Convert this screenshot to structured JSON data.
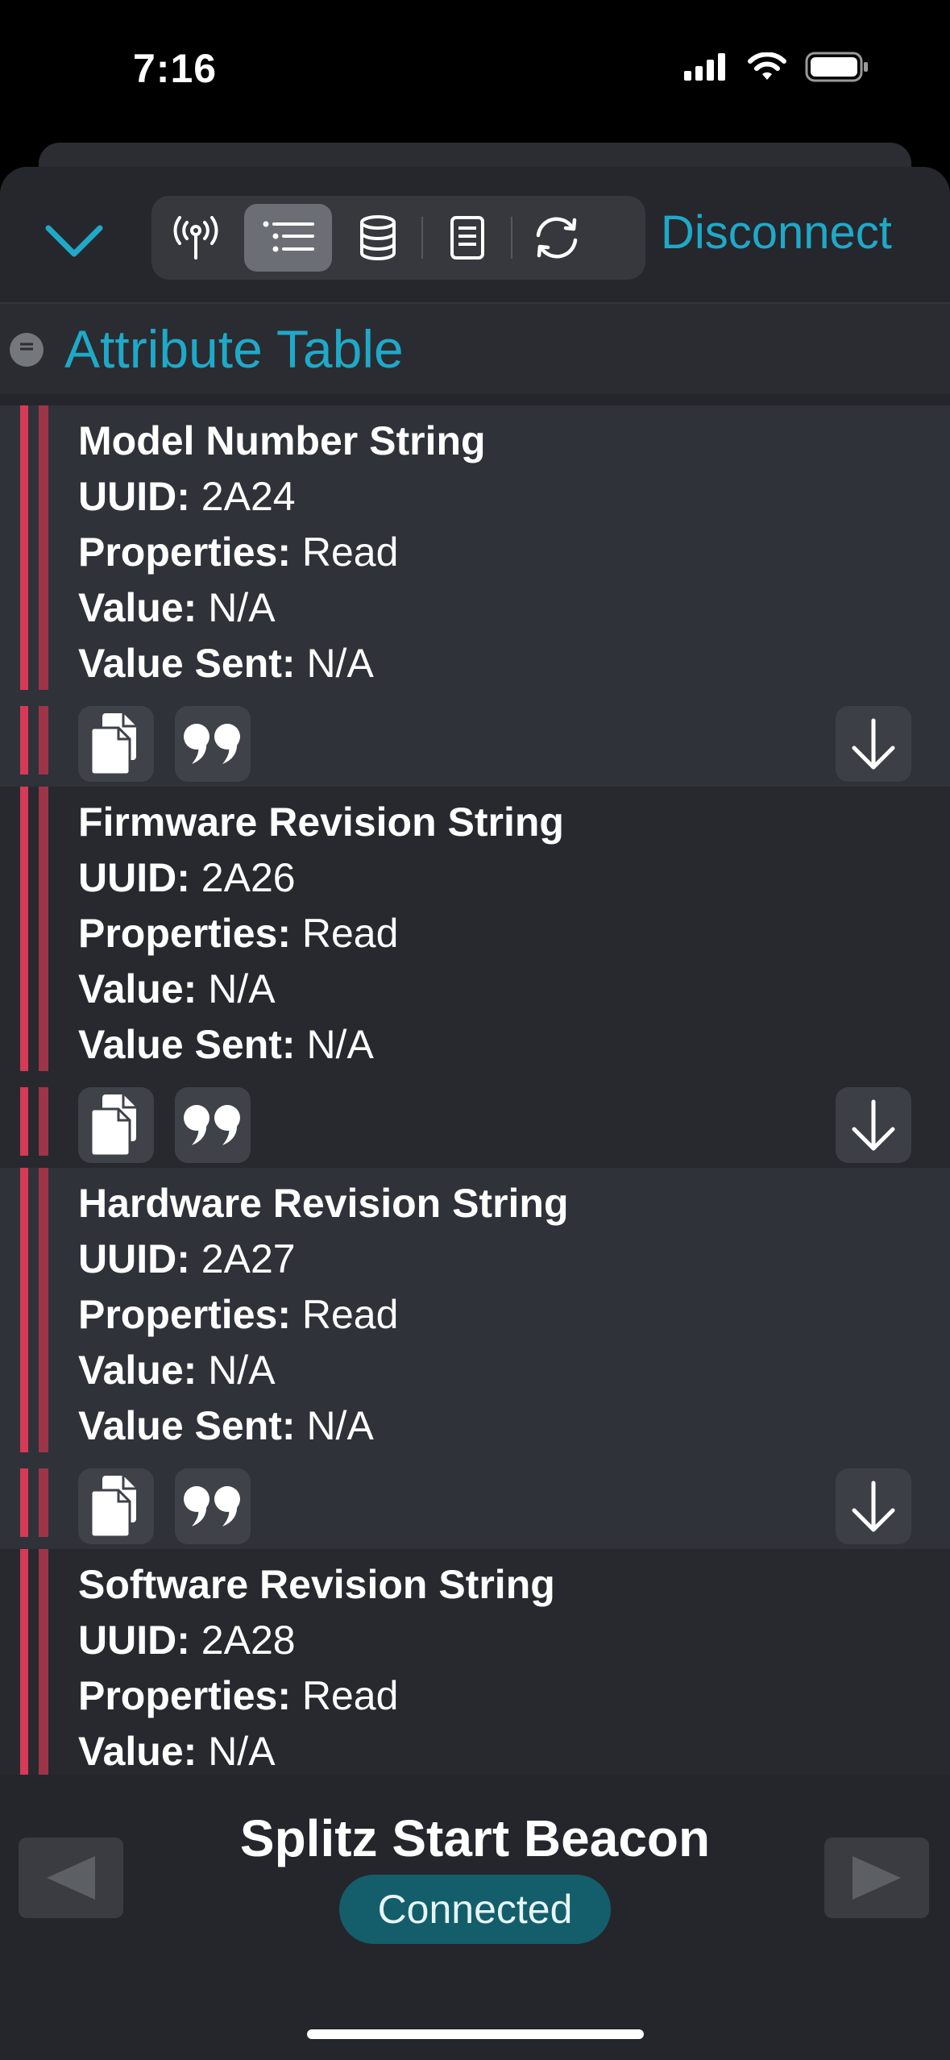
{
  "status_bar": {
    "time": "7:16"
  },
  "toolbar": {
    "collapse_icon": "chevron-down-icon",
    "segments": [
      {
        "icon": "antenna-icon",
        "active": false
      },
      {
        "icon": "list-icon",
        "active": true
      },
      {
        "icon": "database-icon",
        "active": false
      },
      {
        "icon": "document-icon",
        "active": false
      },
      {
        "icon": "refresh-icon",
        "active": false
      }
    ],
    "disconnect_label": "Disconnect"
  },
  "section": {
    "title": "Attribute Table"
  },
  "labels": {
    "uuid": "UUID:",
    "properties": "Properties:",
    "value": "Value:",
    "value_sent": "Value Sent:"
  },
  "characteristics": [
    {
      "name": "Model Number String",
      "uuid": "2A24",
      "properties": "Read",
      "value": "N/A",
      "value_sent": "N/A"
    },
    {
      "name": "Firmware Revision String",
      "uuid": "2A26",
      "properties": "Read",
      "value": "N/A",
      "value_sent": "N/A"
    },
    {
      "name": "Hardware Revision String",
      "uuid": "2A27",
      "properties": "Read",
      "value": "N/A",
      "value_sent": "N/A"
    },
    {
      "name": "Software Revision String",
      "uuid": "2A28",
      "properties": "Read",
      "value": "N/A"
    }
  ],
  "device": {
    "name": "Splitz Start Beacon",
    "status": "Connected"
  },
  "colors": {
    "accent": "#1fa9c9",
    "stripe": "#d63a57",
    "badge": "#145e6b"
  }
}
